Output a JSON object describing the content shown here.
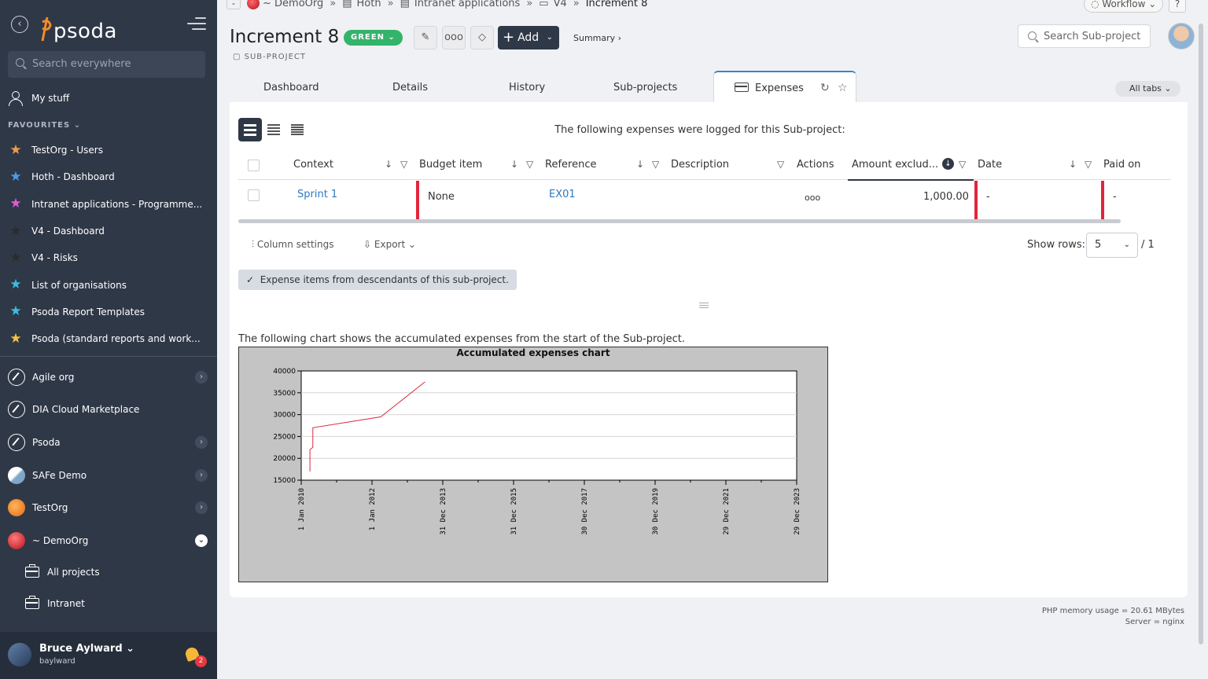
{
  "app": {
    "logo": "psoda"
  },
  "sidebar": {
    "search_placeholder": "Search everywhere",
    "my_stuff": "My stuff",
    "favourites_header": "FAVOURITES",
    "favourites": [
      {
        "label": "TestOrg - Users",
        "color": "#f39a4b"
      },
      {
        "label": "Hoth - Dashboard",
        "color": "#4a9be8"
      },
      {
        "label": "Intranet applications - Programme...",
        "color": "#e05bd6"
      },
      {
        "label": "V4 - Dashboard",
        "color": "#2b2b2b"
      },
      {
        "label": "V4 - Risks",
        "color": "#2b2b2b"
      },
      {
        "label": "List of organisations",
        "color": "#3bbde6"
      },
      {
        "label": "Psoda Report Templates",
        "color": "#3bbde6"
      },
      {
        "label": "Psoda (standard reports and work...",
        "color": "#f5c33b"
      }
    ],
    "orgs": [
      {
        "label": "Agile org",
        "chevron": "›"
      },
      {
        "label": "DIA Cloud Marketplace",
        "chevron": ""
      },
      {
        "label": "Psoda",
        "chevron": "›"
      },
      {
        "label": "SAFe Demo",
        "chevron": "›"
      },
      {
        "label": "TestOrg",
        "chevron": "›"
      },
      {
        "label": "~ DemoOrg",
        "chevron": "⌄"
      }
    ],
    "sub_items": [
      "All projects",
      "Intranet"
    ],
    "user": {
      "name": "Bruce Aylward ⌄",
      "username": "baylward",
      "notifications": "2"
    }
  },
  "breadcrumb": {
    "items": [
      "~ DemoOrg",
      "Hoth",
      "Intranet applications",
      "V4"
    ],
    "current": "Increment 8"
  },
  "header": {
    "title": "Increment 8",
    "status": "GREEN",
    "type": "SUB-PROJECT",
    "add_label": "Add",
    "summary_link": "Summary ›",
    "search_placeholder": "Search Sub-project (",
    "workflow_label": "Workflow",
    "help_label": "?"
  },
  "tabs": {
    "items": [
      "Dashboard",
      "Details",
      "History",
      "Sub-projects"
    ],
    "active": "Expenses",
    "all_tabs": "All tabs"
  },
  "expenses": {
    "caption": "The following expenses were logged for this Sub-project:",
    "columns": [
      "Context",
      "Budget item",
      "Reference",
      "Description",
      "Actions",
      "Amount exclud...",
      "Date",
      "Paid on"
    ],
    "rows": [
      {
        "context": "Sprint 1",
        "budget_item": "None",
        "reference": "EX01",
        "description": "",
        "actions": "ooo",
        "amount": "1,000.00",
        "date": "-",
        "paid_on": "-"
      }
    ],
    "column_settings": "Column settings",
    "export": "Export",
    "show_rows_label": "Show rows:",
    "show_rows_value": "5",
    "page_total": "/ 1",
    "descendants_chip": "Expense items from descendants of this sub-project."
  },
  "chart_caption": "The following chart shows the accumulated expenses from the start of the Sub-project.",
  "chart_data": {
    "type": "line",
    "title": "Accumulated expenses chart",
    "xlabel": "",
    "ylabel": "",
    "x_tick_labels": [
      "1 Jan 2010",
      "1 Jan 2012",
      "31 Dec 2013",
      "31 Dec 2015",
      "30 Dec 2017",
      "30 Dec 2019",
      "29 Dec 2021",
      "29 Dec 2023"
    ],
    "x_range": [
      "2010-01-01",
      "2023-12-29"
    ],
    "y_ticks": [
      15000,
      20000,
      25000,
      30000,
      35000,
      40000
    ],
    "ylim": [
      15000,
      40000
    ],
    "grid": true,
    "line_color": "#e0263b",
    "series": [
      {
        "name": "",
        "points": [
          {
            "x": "2010-04-01",
            "y": 17000
          },
          {
            "x": "2010-04-01",
            "y": 22000
          },
          {
            "x": "2010-05-01",
            "y": 22500
          },
          {
            "x": "2010-05-01",
            "y": 27000
          },
          {
            "x": "2012-04-01",
            "y": 29500
          },
          {
            "x": "2013-07-01",
            "y": 37500
          }
        ]
      }
    ]
  },
  "footer": {
    "memory": "PHP memory usage = 20.61 MBytes",
    "server": "Server = nginx"
  }
}
